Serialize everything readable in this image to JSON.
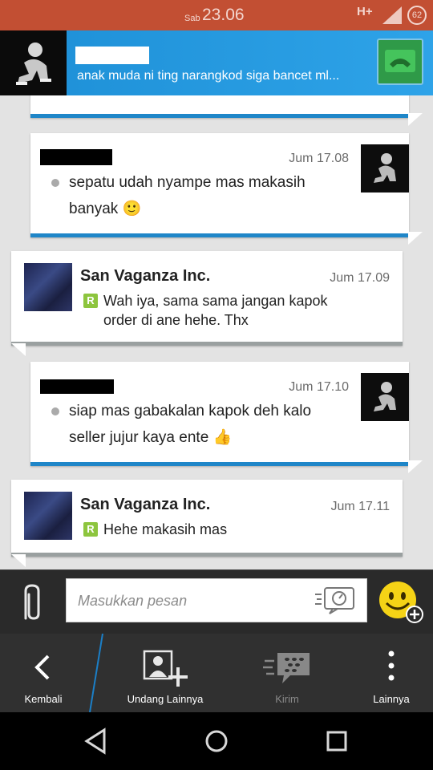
{
  "status_bar": {
    "day": "Sab",
    "time": "23.06",
    "network": "H+",
    "battery": "62"
  },
  "header": {
    "status_message": "anak muda ni ting narangkod siga bancet ml..."
  },
  "messages": [
    {
      "direction": "out",
      "time": "Jum 17.08",
      "text_line1": "sepatu udah nyampe mas makasih",
      "text_line2": "banyak 🙂"
    },
    {
      "direction": "in",
      "sender": "San Vaganza Inc.",
      "time": "Jum 17.09",
      "badge": "R",
      "text_line1": "Wah iya, sama sama jangan kapok",
      "text_line2": "order di ane hehe. Thx"
    },
    {
      "direction": "out",
      "time": "Jum 17.10",
      "text_line1": "siap mas gabakalan kapok deh kalo",
      "text_line2": "seller jujur kaya ente 👍"
    },
    {
      "direction": "in",
      "sender": "San Vaganza Inc.",
      "time": "Jum 17.11",
      "badge": "R",
      "text_line1": "Hehe makasih mas"
    }
  ],
  "compose": {
    "placeholder": "Masukkan pesan"
  },
  "toolbar": {
    "back_label": "Kembali",
    "invite_label": "Undang Lainnya",
    "send_label": "Kirim",
    "more_label": "Lainnya"
  },
  "colors": {
    "status_bar": "#c24f33",
    "header_blue": "#1d8fd6",
    "out_accent": "#1f86c8",
    "badge_green": "#8dc53e"
  }
}
